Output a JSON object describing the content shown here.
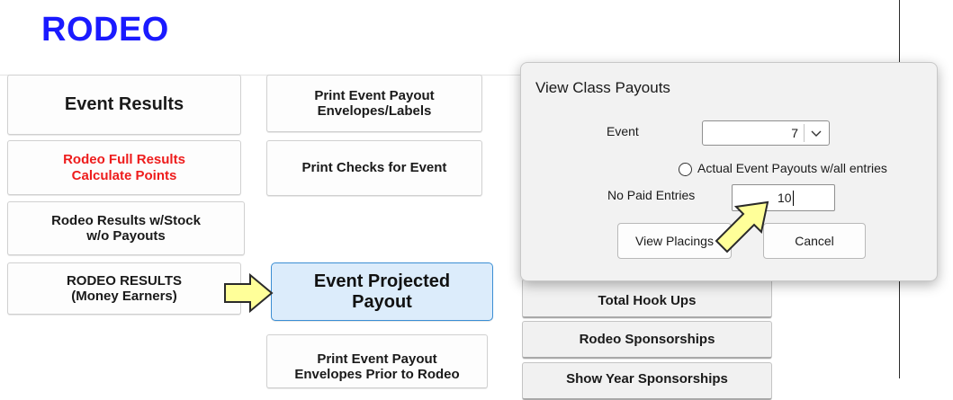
{
  "app": {
    "title": "RODEO"
  },
  "left_buttons": [
    {
      "l1": "Event Results",
      "l2": ""
    },
    {
      "l1": "Rodeo Full Results",
      "l2": "Calculate Points"
    },
    {
      "l1": "Rodeo Results w/Stock",
      "l2": "w/o Payouts"
    },
    {
      "l1": "RODEO RESULTS",
      "l2": "(Money Earners)"
    }
  ],
  "middle_buttons": [
    {
      "l1": "Print Event Payout",
      "l2": "Envelopes/Labels"
    },
    {
      "l1": "Print Checks for Event",
      "l2": ""
    },
    {
      "l1": "Event Projected",
      "l2": "Payout"
    },
    {
      "l1": "Print Event Payout",
      "l2": "Envelopes Prior to Rodeo"
    }
  ],
  "right_buttons": [
    {
      "label": "Total Hook Ups"
    },
    {
      "label": "Rodeo Sponsorships"
    },
    {
      "label": "Show Year Sponsorships"
    }
  ],
  "dialog": {
    "title": "View Class Payouts",
    "event_label": "Event",
    "event_value": "7",
    "radio_label": "Actual Event Payouts w/all entries",
    "radio_checked": false,
    "no_paid_label": "No Paid Entries",
    "no_paid_value": "10",
    "view_button": "View Placings",
    "cancel_button": "Cancel"
  },
  "colors": {
    "title_blue": "#1a1aff",
    "red_text": "#ee1c1c",
    "arrow_fill": "#ffff99",
    "active_button": "#dcecfb"
  },
  "icons": [
    "chevron-down-icon",
    "yellow-pointer-arrow"
  ]
}
